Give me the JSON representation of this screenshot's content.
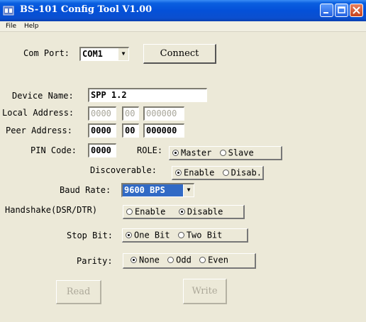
{
  "window": {
    "title": "BS-101 Config Tool V1.00"
  },
  "menu": {
    "file": "File",
    "help": "Help"
  },
  "com_port": {
    "label": "Com Port:",
    "value": "COM1"
  },
  "connect_button": "Connect",
  "device_name": {
    "label": "Device Name:",
    "value": "SPP 1.2"
  },
  "local_address": {
    "label": "Local Address:",
    "parts": [
      "0000",
      "00",
      "000000"
    ]
  },
  "peer_address": {
    "label": "Peer Address:",
    "parts": [
      "0000",
      "00",
      "000000"
    ]
  },
  "pin_code": {
    "label": "PIN Code:",
    "value": "0000"
  },
  "role": {
    "label": "ROLE:",
    "options": [
      "Master",
      "Slave"
    ],
    "selected": "Master"
  },
  "discoverable": {
    "label": "Discoverable:",
    "options": [
      "Enable",
      "Disab."
    ],
    "selected": "Enable"
  },
  "baud_rate": {
    "label": "Baud Rate:",
    "value": "9600 BPS"
  },
  "handshake": {
    "label": "Handshake(DSR/DTR)",
    "options": [
      "Enable",
      "Disable"
    ],
    "selected": "Disable"
  },
  "stop_bit": {
    "label": "Stop Bit:",
    "options": [
      "One Bit",
      "Two Bit"
    ],
    "selected": "One Bit"
  },
  "parity": {
    "label": "Parity:",
    "options": [
      "None",
      "Odd",
      "Even"
    ],
    "selected": "None"
  },
  "buttons": {
    "read": "Read",
    "write": "Write"
  }
}
